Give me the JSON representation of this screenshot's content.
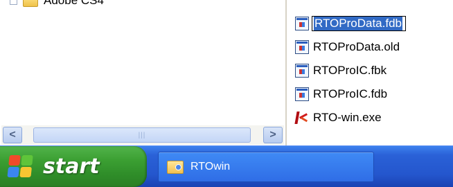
{
  "tree": {
    "item_label": "Adobe CS4"
  },
  "files": [
    {
      "name": "RTOProData.fdb",
      "icon": "database-file-icon",
      "renaming": true
    },
    {
      "name": "RTOProData.old",
      "icon": "database-file-icon"
    },
    {
      "name": "RTOProIC.fbk",
      "icon": "database-file-icon"
    },
    {
      "name": "RTOProIC.fdb",
      "icon": "database-file-icon"
    },
    {
      "name": "RTO-win.exe",
      "icon": "application-exe-icon"
    }
  ],
  "scrollbar": {
    "left_arrow": "<",
    "right_arrow": ">",
    "grip": "|||"
  },
  "taskbar": {
    "start_label": "start",
    "task_label": "RTOwin",
    "task_icon": "folder-icon"
  },
  "colors": {
    "taskbar_blue": "#2456cd",
    "start_green": "#3b9f32",
    "selection_blue": "#316ac5"
  }
}
